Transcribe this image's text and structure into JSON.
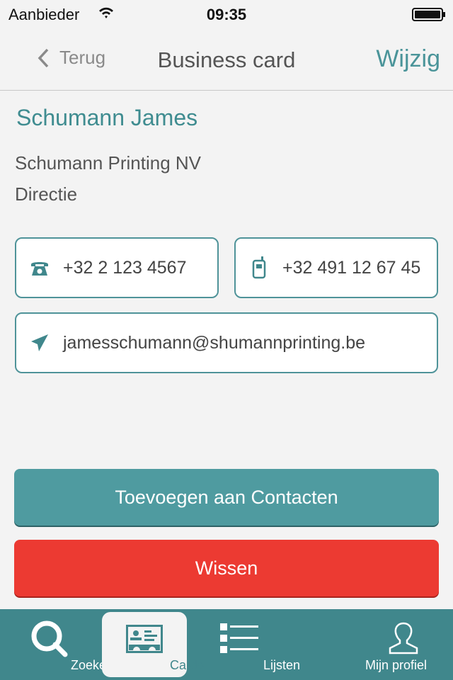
{
  "status": {
    "carrier": "Aanbieder",
    "time": "09:35",
    "battery_percent": 100
  },
  "nav": {
    "back_label": "Terug",
    "title": "Business card",
    "edit_label": "Wijzig"
  },
  "contact": {
    "name": "Schumann James",
    "company": "Schumann Printing NV",
    "role": "Directie",
    "phone": "+32 2 123 4567",
    "mobile": "+32 491 12 67 45",
    "email": "jamesschumann@shumannprinting.be"
  },
  "actions": {
    "add_label": "Toevoegen aan Contacten",
    "delete_label": "Wissen"
  },
  "tabs": [
    {
      "label": "Zoeken",
      "icon": "search-icon"
    },
    {
      "label": "Cards",
      "icon": "card-icon",
      "active": true
    },
    {
      "label": "Lijsten",
      "icon": "list-icon"
    },
    {
      "label": "Mijn profiel",
      "icon": "user-icon"
    }
  ],
  "colors": {
    "accent": "#4f9ba0",
    "danger": "#ec3a32",
    "tabbar": "#40878c"
  }
}
